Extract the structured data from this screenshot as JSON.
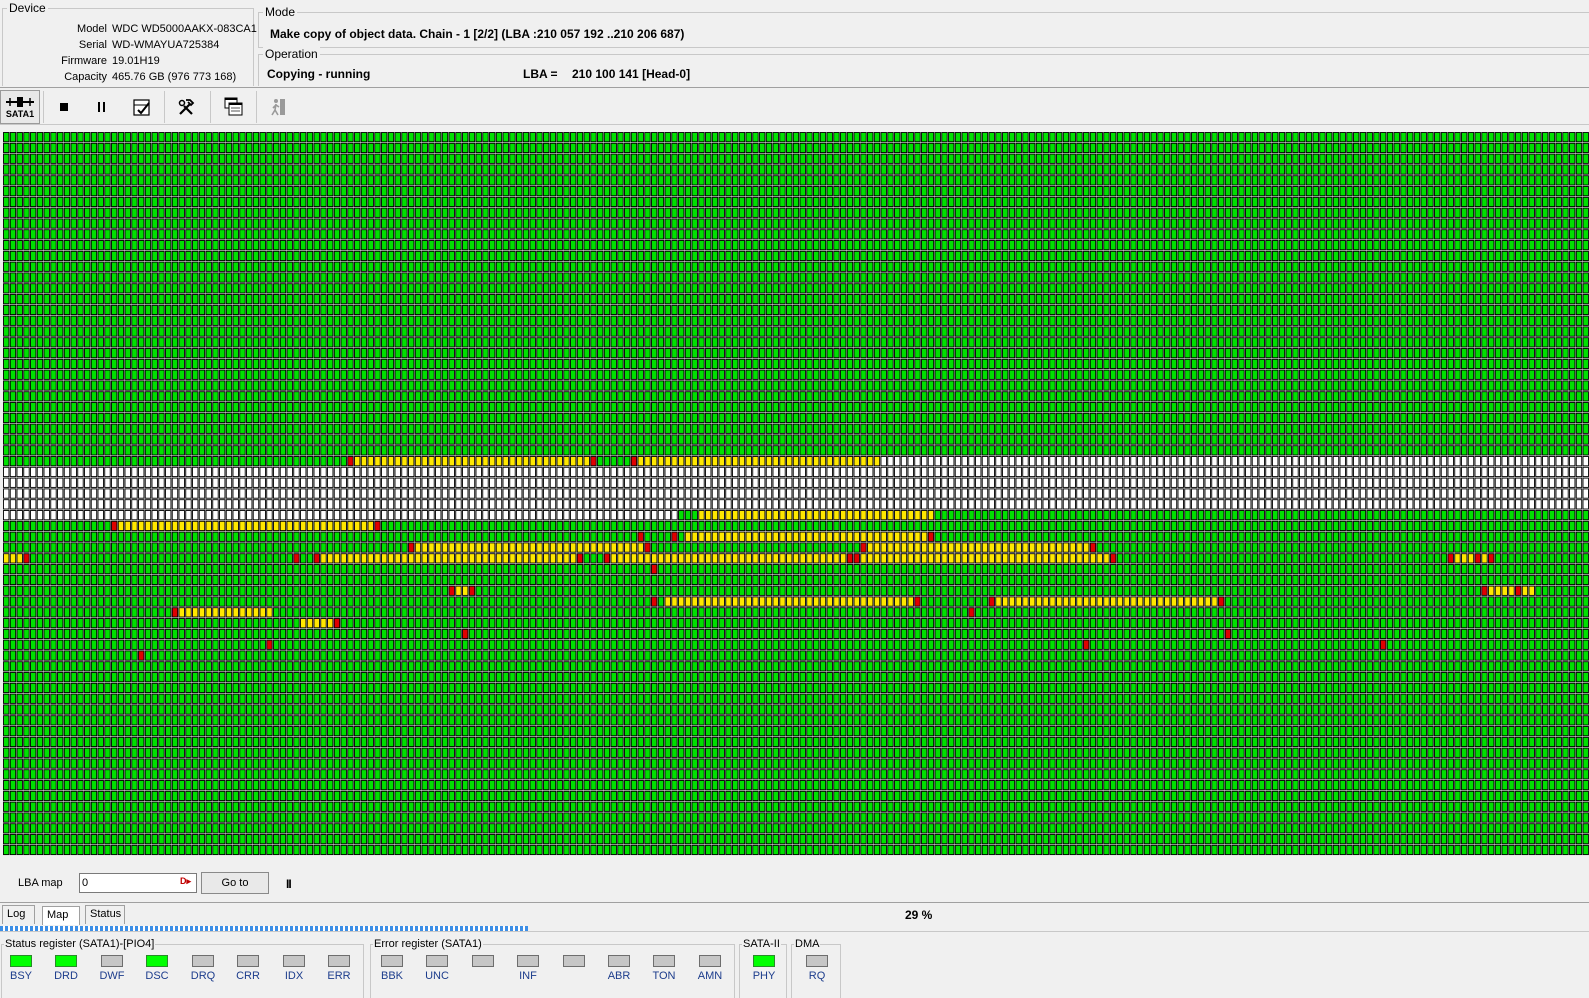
{
  "device": {
    "title": "Device",
    "rows": [
      {
        "label": "Model",
        "value": "WDC WD5000AAKX-083CA1"
      },
      {
        "label": "Serial",
        "value": "WD-WMAYUA725384"
      },
      {
        "label": "Firmware",
        "value": "19.01H19"
      },
      {
        "label": "Capacity",
        "value": "465.76 GB (976 773 168)"
      }
    ]
  },
  "mode": {
    "title": "Mode",
    "text": "Make copy of object data. Chain - 1 [2/2] (LBA :210 057 192 ..210 206 687)"
  },
  "operation": {
    "title": "Operation",
    "status": "Copying - running",
    "lba_label": "LBA =",
    "lba_value": "210 100 141  [Head-0]"
  },
  "toolbar": {
    "port_label": "SATA1",
    "buttons": [
      "stop-icon",
      "pause-icon",
      "checklist-icon",
      "tools-icon",
      "copy-windows-icon",
      "exit-icon"
    ]
  },
  "map": {
    "colors": {
      "ok": "#00e000",
      "pending": "#ffe800",
      "error": "#e00000",
      "empty": "#ffffff",
      "border": "#000000"
    }
  },
  "lba_map": {
    "label": "LBA map",
    "value": "0",
    "goto_label": "Go to",
    "pause_glyph": "II"
  },
  "tabs": [
    {
      "label": "Log",
      "active": false
    },
    {
      "label": "Map",
      "active": true
    },
    {
      "label": "Status",
      "active": false
    }
  ],
  "progress": {
    "percent_text": "29 %",
    "fraction": 0.29
  },
  "status_register": {
    "title": "Status register (SATA1)-[PIO4]",
    "leds": [
      {
        "name": "BSY",
        "on": true
      },
      {
        "name": "DRD",
        "on": true
      },
      {
        "name": "DWF",
        "on": false
      },
      {
        "name": "DSC",
        "on": true
      },
      {
        "name": "DRQ",
        "on": false
      },
      {
        "name": "CRR",
        "on": false
      },
      {
        "name": "IDX",
        "on": false
      },
      {
        "name": "ERR",
        "on": false
      }
    ]
  },
  "error_register": {
    "title": "Error register (SATA1)",
    "leds": [
      {
        "name": "BBK",
        "on": false
      },
      {
        "name": "UNC",
        "on": false
      },
      {
        "name": "",
        "on": false
      },
      {
        "name": "INF",
        "on": false
      },
      {
        "name": "",
        "on": false
      },
      {
        "name": "ABR",
        "on": false
      },
      {
        "name": "TON",
        "on": false
      },
      {
        "name": "AMN",
        "on": false
      }
    ]
  },
  "sata2": {
    "title": "SATA-II",
    "leds": [
      {
        "name": "PHY",
        "on": true
      }
    ]
  },
  "dma": {
    "title": "DMA",
    "leds": [
      {
        "name": "RQ",
        "on": false
      }
    ]
  }
}
